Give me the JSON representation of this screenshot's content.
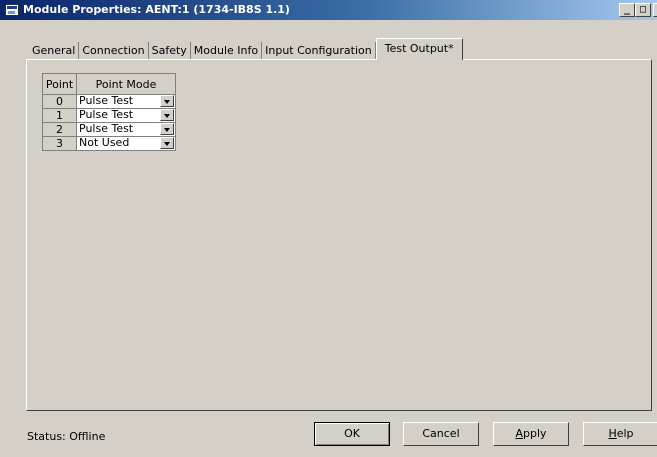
{
  "window": {
    "title": "Module Properties: AENT:1 (1734-IB8S 1.1)",
    "controls": {
      "minimize": "_",
      "maximize": "□",
      "close": "x"
    }
  },
  "tabs": [
    {
      "label": "General"
    },
    {
      "label": "Connection"
    },
    {
      "label": "Safety"
    },
    {
      "label": "Module Info"
    },
    {
      "label": "Input Configuration"
    },
    {
      "label": "Test Output*",
      "active": true
    }
  ],
  "grid": {
    "headers": {
      "point": "Point",
      "mode": "Point Mode"
    },
    "rows": [
      {
        "point": "0",
        "mode": "Pulse Test"
      },
      {
        "point": "1",
        "mode": "Pulse Test"
      },
      {
        "point": "2",
        "mode": "Pulse Test"
      },
      {
        "point": "3",
        "mode": "Not Used"
      }
    ]
  },
  "status": {
    "label": "Status:",
    "value": "Offline"
  },
  "buttons": {
    "ok": "OK",
    "cancel": "Cancel",
    "apply_first": "A",
    "apply_rest": "pply",
    "help_first": "H",
    "help_rest": "elp"
  }
}
